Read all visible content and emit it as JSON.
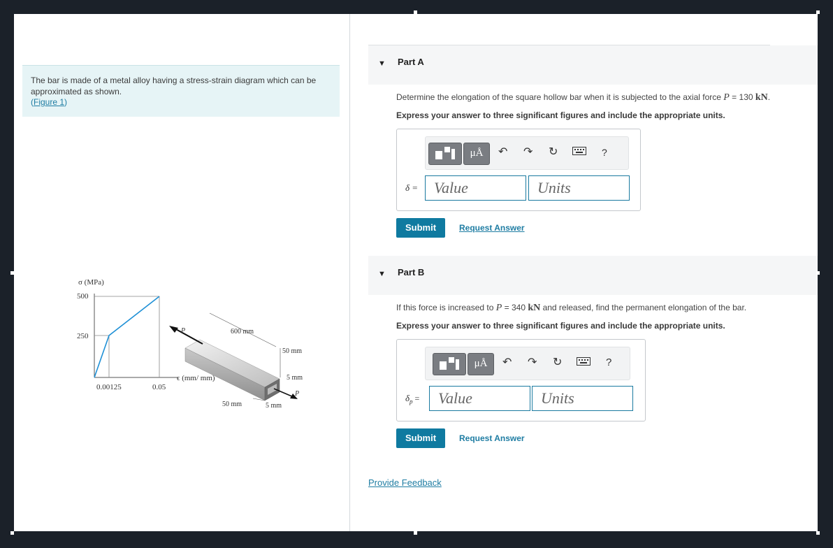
{
  "problem": {
    "text": "The bar is made of a metal alloy having a stress-strain diagram which can be approximated as shown.",
    "figure_link": "Figure 1"
  },
  "figure": {
    "y_axis_label": "σ (MPa)",
    "y_ticks": [
      "500",
      "250"
    ],
    "x_ticks": [
      "0.00125",
      "0.05"
    ],
    "x_axis_label": "ϵ (mm/ mm)",
    "dims": [
      "600 mm",
      "50 mm",
      "5 mm",
      "50 mm",
      "5 mm"
    ],
    "force_label": "P"
  },
  "partA": {
    "title": "Part A",
    "question_prefix": "Determine the elongation of the square hollow bar when it is subjected to the axial force ",
    "force_symbol": "P",
    "force_value": " = 130 ",
    "force_unit": "kN",
    "question_suffix": ".",
    "instruction": "Express your answer to three significant figures and include the appropriate units.",
    "symbol": "δ =",
    "value_placeholder": "Value",
    "units_placeholder": "Units",
    "submit": "Submit",
    "request": "Request Answer"
  },
  "partB": {
    "title": "Part B",
    "question_prefix": "If this force is increased to ",
    "force_symbol": "P",
    "force_value": " = 340 ",
    "force_unit": "kN",
    "question_suffix": " and released, find the permanent elongation of the bar.",
    "instruction": "Express your answer to three significant figures and include the appropriate units.",
    "symbol": "δ",
    "symbol_sub": "p",
    "symbol_eq": " =",
    "value_placeholder": "Value",
    "units_placeholder": "Units",
    "submit": "Submit",
    "request": "Request Answer"
  },
  "toolbar": {
    "units_label": "μÅ",
    "help": "?"
  },
  "feedback": "Provide Feedback"
}
